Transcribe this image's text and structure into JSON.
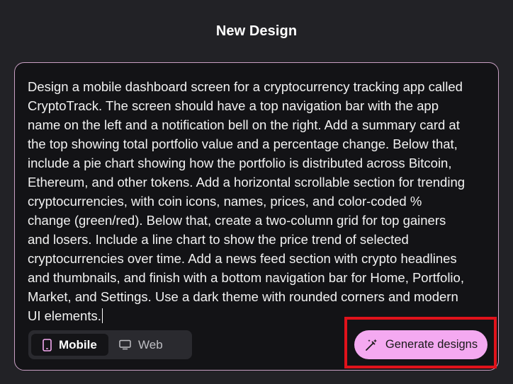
{
  "header": {
    "title": "New Design"
  },
  "prompt": {
    "text": "Design a mobile dashboard screen for a cryptocurrency tracking app called\nCryptoTrack. The screen should have a top navigation bar with the app\nname on the left and a notification bell on the right. Add a summary card at\nthe top showing total portfolio value and a percentage change. Below that,\ninclude a pie chart showing how the portfolio is distributed across Bitcoin,\nEthereum, and other tokens. Add a horizontal scrollable section for trending\ncryptocurrencies, with coin icons, names, prices, and color-coded %\nchange (green/red). Below that, create a two-column grid for top gainers\nand losers. Include a line chart to show the price trend of selected\ncryptocurrencies over time. Add a news feed section with crypto headlines\nand thumbnails, and finish with a bottom navigation bar for Home, Portfolio,\nMarket, and Settings. Use a dark theme with rounded corners and modern\nUI elements."
  },
  "platform_toggle": {
    "selected": "Mobile",
    "options": [
      {
        "label": "Mobile",
        "icon": "mobile-phone-icon"
      },
      {
        "label": "Web",
        "icon": "monitor-icon"
      }
    ]
  },
  "actions": {
    "generate_label": "Generate designs",
    "generate_icon": "magic-wand-icon"
  },
  "colors": {
    "background": "#222226",
    "editor_background": "#131316",
    "editor_border": "#c9a0c4",
    "accent": "#f4a9f1",
    "highlight": "#e0121b"
  }
}
